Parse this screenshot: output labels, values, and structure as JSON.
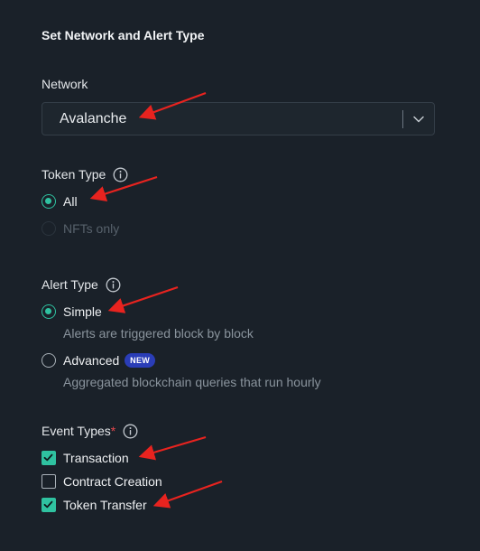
{
  "section_title": "Set Network and Alert Type",
  "network": {
    "label": "Network",
    "value": "Avalanche"
  },
  "token_type": {
    "label": "Token Type",
    "options": [
      {
        "label": "All",
        "checked": true,
        "disabled": false
      },
      {
        "label": "NFTs only",
        "checked": false,
        "disabled": true
      }
    ]
  },
  "alert_type": {
    "label": "Alert Type",
    "options": [
      {
        "label": "Simple",
        "description": "Alerts are triggered block by block",
        "checked": true
      },
      {
        "label": "Advanced",
        "badge": "NEW",
        "description": "Aggregated blockchain queries that run hourly",
        "checked": false
      }
    ]
  },
  "event_types": {
    "label": "Event Types",
    "required_mark": "*",
    "options": [
      {
        "label": "Transaction",
        "checked": true
      },
      {
        "label": "Contract Creation",
        "checked": false
      },
      {
        "label": "Token Transfer",
        "checked": true
      }
    ]
  },
  "colors": {
    "background": "#1a2129",
    "accent": "#2fc2a0",
    "badge": "#2a3db7",
    "annotation_arrow": "#e8231f"
  }
}
